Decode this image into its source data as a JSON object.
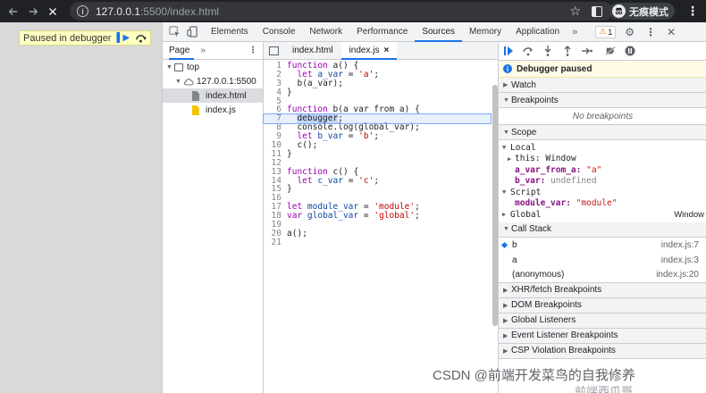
{
  "browser": {
    "url_host": "127.0.0.1",
    "url_rest": ":5500/index.html",
    "incognito_label": "无痕模式"
  },
  "page": {
    "paused_text": "Paused in debugger"
  },
  "devtools": {
    "tabs": [
      "Elements",
      "Console",
      "Network",
      "Performance",
      "Sources",
      "Memory",
      "Application"
    ],
    "active_tab": "Sources",
    "more": "»",
    "warning_count": "1"
  },
  "navigator": {
    "tab": "Page",
    "more": "»",
    "tree": {
      "top": "top",
      "origin": "127.0.0.1:5500",
      "files": [
        "index.html",
        "index.js"
      ]
    }
  },
  "editor": {
    "tabs": [
      "index.html",
      "index.js"
    ],
    "active_tab": "index.js",
    "close": "×",
    "paused_line": 7,
    "lines": [
      "function a() {",
      "  let a_var = 'a';",
      "  b(a_var);",
      "}",
      "",
      "function b(a_var_from_a) {",
      "  debugger;",
      "  console.log(global_var);",
      "  let b_var = 'b';",
      "  c();",
      "}",
      "",
      "function c() {",
      "  let c_var = 'c';",
      "}",
      "",
      "let module_var = 'module';",
      "var global_var = 'global';",
      "",
      "a();",
      ""
    ]
  },
  "sidebar": {
    "paused_banner": "Debugger paused",
    "watch": "Watch",
    "breakpoints": "Breakpoints",
    "no_breakpoints": "No breakpoints",
    "scope": "Scope",
    "scope_local": "Local",
    "this_label": "this:",
    "this_value": "Window",
    "a_var_from_a_key": "a_var_from_a:",
    "a_var_from_a_val": "\"a\"",
    "b_var_key": "b_var:",
    "b_var_val": "undefined",
    "scope_script": "Script",
    "module_var_key": "module_var:",
    "module_var_val": "\"module\"",
    "scope_global": "Global",
    "global_value": "Window",
    "call_stack": "Call Stack",
    "frames": [
      {
        "name": "b",
        "loc": "index.js:7"
      },
      {
        "name": "a",
        "loc": "index.js:3"
      },
      {
        "name": "(anonymous)",
        "loc": "index.js:20"
      }
    ],
    "collapsed_panes": [
      "XHR/fetch Breakpoints",
      "DOM Breakpoints",
      "Global Listeners",
      "Event Listener Breakpoints",
      "CSP Violation Breakpoints"
    ]
  },
  "watermark": "CSDN @前端开发菜鸟的自我修养",
  "watermark2": "前端西瓜哥"
}
